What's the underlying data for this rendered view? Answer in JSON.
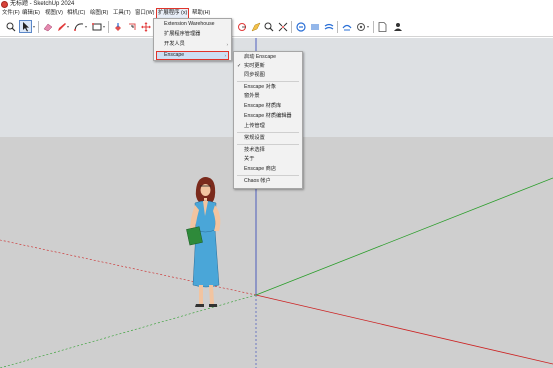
{
  "titlebar": {
    "title": "无标题 - SketchUp 2024"
  },
  "menubar": {
    "items": [
      {
        "label": "文件(F)"
      },
      {
        "label": "编辑(E)"
      },
      {
        "label": "视图(V)"
      },
      {
        "label": "相机(C)"
      },
      {
        "label": "绘图(R)"
      },
      {
        "label": "工具(T)"
      },
      {
        "label": "窗口(W)"
      },
      {
        "label": "扩展程序 (x)"
      },
      {
        "label": "帮助(H)"
      }
    ],
    "active_index": 7
  },
  "extensions_menu": {
    "items": [
      {
        "label": "Extension Warehouse"
      },
      {
        "label": "扩展程序管理器"
      },
      {
        "label": "开发人员",
        "submenu": "›"
      },
      {
        "label": "Enscape",
        "submenu": "›"
      }
    ],
    "highlighted_index": 3
  },
  "enscape_submenu": {
    "items": [
      {
        "label": "启动 Enscape"
      },
      {
        "label": "实时更新",
        "checked": "✓"
      },
      {
        "label": "同步视图"
      },
      {
        "label": "Enscape 对象"
      },
      {
        "label": "窗外景"
      },
      {
        "label": "Enscape 材质库"
      },
      {
        "label": "Enscape 材质编辑器"
      },
      {
        "label": "上传管理"
      },
      {
        "label": "常规设置"
      },
      {
        "label": "技术选择"
      },
      {
        "label": "关于"
      },
      {
        "label": "Enscape 商店"
      },
      {
        "label": "Chaos 帐户"
      }
    ]
  },
  "toolbar": {
    "icons": [
      "zoom-icon",
      "select-arrow-icon",
      "eraser-icon",
      "pencil-icon",
      "arc-icon",
      "shape-icon",
      "push-pull-icon",
      "offset-icon",
      "move-icon",
      "rotate-icon",
      "follow-me-icon",
      "tape-measure-icon",
      "text-icon",
      "section-plane-icon",
      "orbit-icon",
      "pan-icon",
      "zoom-extents-icon",
      "styles-icon",
      "x-ray-icon",
      "shadows-icon",
      "materials-icon",
      "components-icon",
      "warehouse-icon",
      "new-file-icon",
      "account-icon"
    ]
  },
  "colors": {
    "highlight_box": "#e0352b",
    "axis_red": "#cc2222",
    "axis_green": "#2a9d2a",
    "axis_blue": "#2b3fb6",
    "sky": "#dde0e3",
    "ground": "#cfcfcf"
  }
}
